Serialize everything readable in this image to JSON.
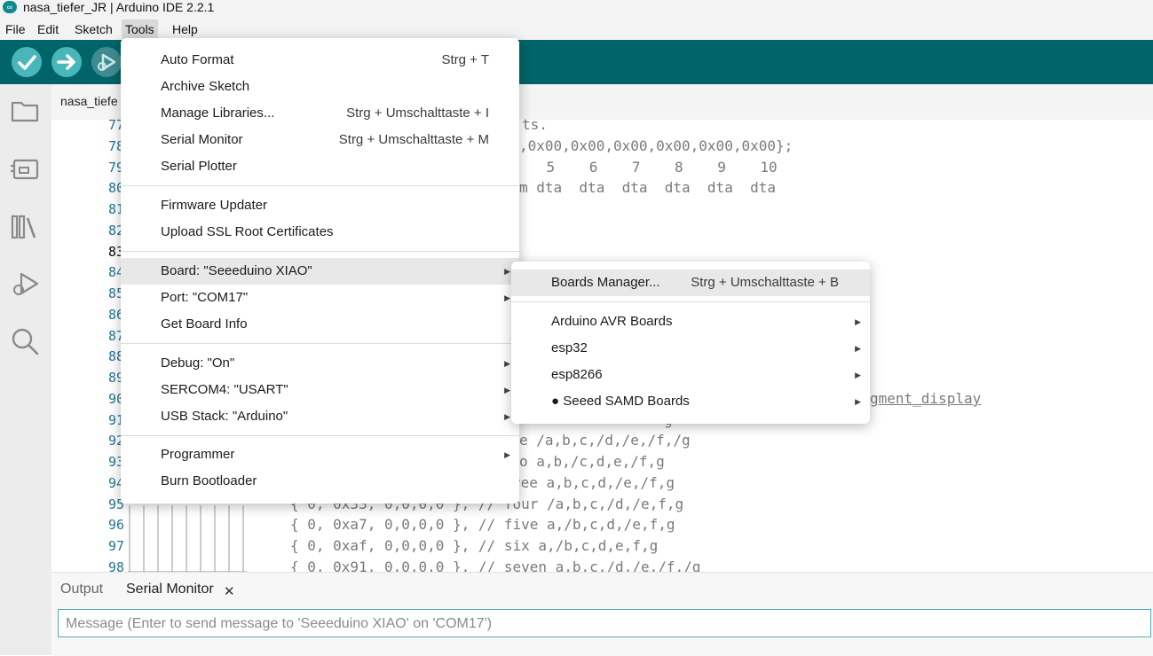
{
  "window": {
    "title": "nasa_tiefer_JR | Arduino IDE 2.2.1",
    "logo_glyph": "∞"
  },
  "menubar": [
    "File",
    "Edit",
    "Sketch",
    "Tools",
    "Help"
  ],
  "toolbar": {
    "verify": "check-icon",
    "upload": "arrow-right-icon",
    "debug": "debug-icon"
  },
  "activity_bar": [
    "folder-icon",
    "board-icon",
    "library-icon",
    "debug-icon",
    "search-icon"
  ],
  "editor": {
    "tab": "nasa_tiefe",
    "line_numbers": [
      "77",
      "78",
      "79",
      "80",
      "81",
      "82",
      "83",
      "84",
      "85",
      "86",
      "87",
      "88",
      "89",
      "90",
      "91",
      "92",
      "93",
      "94",
      "95",
      "96",
      "97",
      "98"
    ],
    "current_line": "83",
    "code": {
      "l77": "ts.",
      "l78": ",0x00,0x00,0x00,0x00,0x00,0x00};",
      "l79": "    5    6    7    8    9    10",
      "l80": "m dta  dta  dta  dta  dta  dta",
      "l90": "gment_display",
      "l91": "g",
      "l92": "e /a,b,c,/d,/e,/f,/g",
      "l93": "o a,b,/c,d,e,/f,g",
      "l94": "ree a,b,c,d,/e,/f,g",
      "l95": "{ 0, 0x33, 0,0,0,0 }, // four /a,b,c,/d,/e,f,g",
      "l96": "{ 0, 0xa7, 0,0,0,0 }, // five a,/b,c,d,/e,f,g",
      "l97": "{ 0, 0xaf, 0,0,0,0 }, // six a,/b,c,d,e,f,g",
      "l98": "{ 0, 0x91, 0,0,0,0 }, // seven a,b,c,/d,/e,/f,/g"
    }
  },
  "tools_menu": {
    "items": [
      {
        "label": "Auto Format",
        "shortcut": "Strg + T"
      },
      {
        "label": "Archive Sketch"
      },
      {
        "label": "Manage Libraries...",
        "shortcut": "Strg + Umschalttaste + I"
      },
      {
        "label": "Serial Monitor",
        "shortcut": "Strg + Umschalttaste + M"
      },
      {
        "label": "Serial Plotter"
      },
      {
        "label": "Firmware Updater"
      },
      {
        "label": "Upload SSL Root Certificates"
      },
      {
        "label": "Board: \"Seeeduino XIAO\"",
        "submenu": true
      },
      {
        "label": "Port: \"COM17\"",
        "submenu": true
      },
      {
        "label": "Get Board Info"
      },
      {
        "label": "Debug: \"On\"",
        "submenu": true
      },
      {
        "label": "SERCOM4: \"USART\"",
        "submenu": true
      },
      {
        "label": "USB Stack: \"Arduino\"",
        "submenu": true
      },
      {
        "label": "Programmer",
        "submenu": true
      },
      {
        "label": "Burn Bootloader"
      }
    ],
    "arrow_glyph": "▶"
  },
  "board_submenu": {
    "items": [
      {
        "label": "Boards Manager...",
        "shortcut": "Strg + Umschalttaste + B"
      },
      {
        "label": "Arduino AVR Boards",
        "submenu": true
      },
      {
        "label": "esp32",
        "submenu": true
      },
      {
        "label": "esp8266",
        "submenu": true
      },
      {
        "label": "● Seeed SAMD Boards",
        "submenu": true
      }
    ]
  },
  "bottom_panel": {
    "tabs": [
      "Output",
      "Serial Monitor"
    ],
    "close_glyph": "✕",
    "message_placeholder": "Message (Enter to send message to 'Seeeduino XIAO' on 'COM17')"
  },
  "colors": {
    "toolbar": "#006468",
    "button": "#49b6ba",
    "line_number": "#237893"
  }
}
